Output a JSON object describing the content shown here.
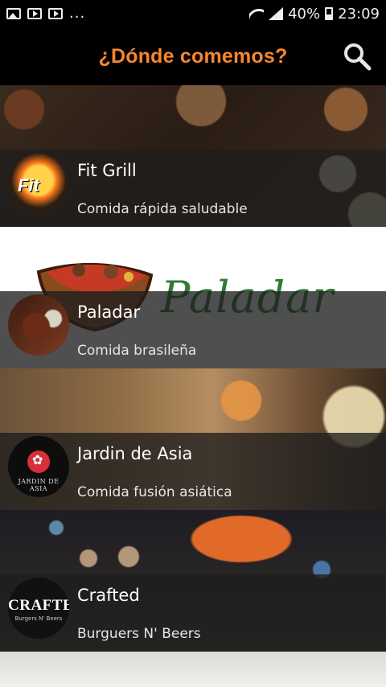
{
  "status_bar": {
    "battery": "40%",
    "time": "23:09",
    "icons": [
      "image-icon",
      "youtube-icon",
      "youtube-icon",
      "more-notifications-icon",
      "wifi-icon",
      "signal-icon",
      "battery-icon"
    ]
  },
  "app_bar": {
    "title": "¿Dónde comemos?",
    "search_icon": "search-icon"
  },
  "restaurants": [
    {
      "name": "Fit Grill",
      "cuisine": "Comida rápida saludable",
      "logo_text": "Fit"
    },
    {
      "name": "Paladar",
      "cuisine": "Comida brasileña",
      "banner_text": "Paladar"
    },
    {
      "name": "Jardin de Asia",
      "cuisine": "Comida fusión asiática",
      "logo_text": "JARDIN DE ASIA"
    },
    {
      "name": "Crafted",
      "cuisine": "Burguers N' Beers",
      "logo_text": "CRAFTED",
      "logo_subtext": "Burgers N' Beers"
    }
  ],
  "colors": {
    "accent": "#f7872e",
    "background": "#000000",
    "overlay": "#1e1e1e"
  }
}
